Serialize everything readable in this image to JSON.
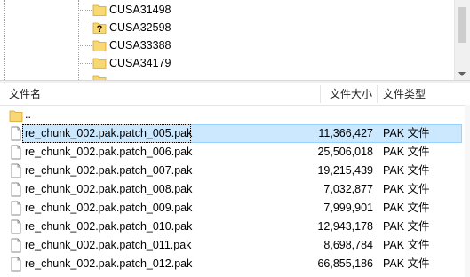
{
  "tree": {
    "items": [
      {
        "label": "CUSA31498",
        "icon": "folder-icon"
      },
      {
        "label": "CUSA32598",
        "icon": "unknown-folder-icon"
      },
      {
        "label": "CUSA33388",
        "icon": "folder-icon"
      },
      {
        "label": "CUSA34179",
        "icon": "folder-icon"
      }
    ]
  },
  "list": {
    "columns": {
      "name": "文件名",
      "size": "文件大小",
      "type": "文件类型"
    },
    "parent_label": "..",
    "rows": [
      {
        "name": "re_chunk_002.pak.patch_005.pak",
        "size": "11,366,427",
        "type": "PAK 文件",
        "selected": true
      },
      {
        "name": "re_chunk_002.pak.patch_006.pak",
        "size": "25,506,018",
        "type": "PAK 文件"
      },
      {
        "name": "re_chunk_002.pak.patch_007.pak",
        "size": "19,215,439",
        "type": "PAK 文件"
      },
      {
        "name": "re_chunk_002.pak.patch_008.pak",
        "size": "7,032,877",
        "type": "PAK 文件"
      },
      {
        "name": "re_chunk_002.pak.patch_009.pak",
        "size": "7,999,901",
        "type": "PAK 文件"
      },
      {
        "name": "re_chunk_002.pak.patch_010.pak",
        "size": "12,943,178",
        "type": "PAK 文件"
      },
      {
        "name": "re_chunk_002.pak.patch_011.pak",
        "size": "8,698,784",
        "type": "PAK 文件"
      },
      {
        "name": "re_chunk_002.pak.patch_012.pak",
        "size": "66,855,186",
        "type": "PAK 文件"
      }
    ]
  },
  "colors": {
    "selection": "#cce8ff",
    "selection_border": "#99d1ff",
    "folder": "#ffd966"
  }
}
